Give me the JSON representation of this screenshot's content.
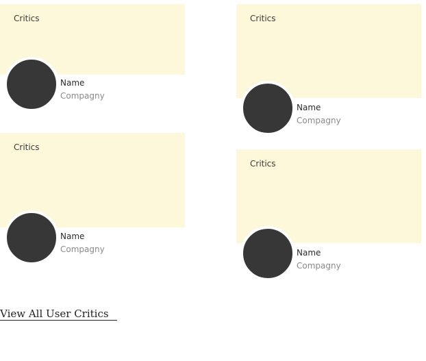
{
  "critics": [
    {
      "quote": "Critics",
      "name": "Name",
      "company": "Compagny"
    },
    {
      "quote": "Critics",
      "name": "Name",
      "company": "Compagny"
    },
    {
      "quote": "Critics",
      "name": "Name",
      "company": "Compagny"
    },
    {
      "quote": "Critics",
      "name": "Name",
      "company": "Compagny"
    }
  ],
  "footer": {
    "view_all_label": "View All User Critics"
  },
  "colors": {
    "quote_background": "#fdf8d9",
    "avatar": "#373737"
  }
}
